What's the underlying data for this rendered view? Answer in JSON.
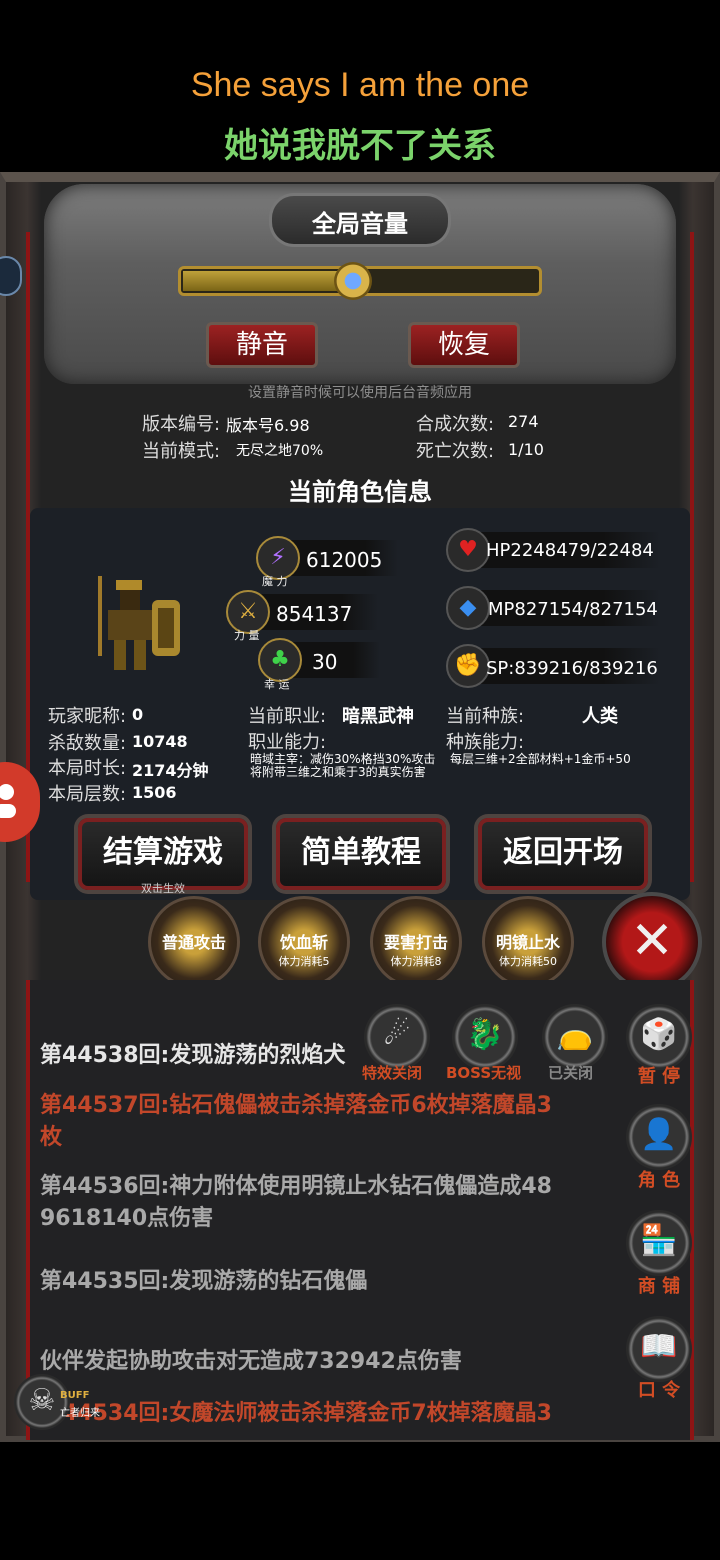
{
  "subtitle": {
    "en": "She says I am the one",
    "zh": "她说我脱不了关系"
  },
  "volume": {
    "title": "全局音量",
    "level": 0.48,
    "mute_label": "静音",
    "restore_label": "恢复",
    "hint": "设置静音时候可以使用后台音频应用"
  },
  "info": {
    "version_label": "版本编号:",
    "version_value": "版本号6.98",
    "mode_label": "当前模式:",
    "mode_value": "无尽之地70%",
    "synth_label": "合成次数:",
    "synth_value": "274",
    "death_label": "死亡次数:",
    "death_value": "1/10"
  },
  "character": {
    "section_title": "当前角色信息",
    "magic": {
      "value": "612005",
      "caption": "魔 力",
      "icon": "lightning-icon"
    },
    "power": {
      "value": "854137",
      "caption": "力 量",
      "icon": "sword-icon"
    },
    "luck": {
      "value": "30",
      "caption": "幸 运",
      "icon": "clover-icon"
    },
    "hp": {
      "value": "HP2248479/22484",
      "icon": "heart-icon"
    },
    "mp": {
      "value": "MP827154/827154",
      "icon": "mana-icon"
    },
    "sp": {
      "value": "SP:839216/839216",
      "icon": "strength-icon"
    },
    "nickname_label": "玩家昵称:",
    "nickname_value": "0",
    "kills_label": "杀敌数量:",
    "kills_value": "10748",
    "time_label": "本局时长:",
    "time_value": "2174分钟",
    "floor_label": "本局层数:",
    "floor_value": "1506",
    "job_label": "当前职业:",
    "job_value": "暗黑武神",
    "job_ability_label": "职业能力:",
    "job_ability_desc_1": "暗域主宰：减伤30%格挡30%攻击",
    "job_ability_desc_2": "将附带三维之和乘于3的真实伤害",
    "race_label": "当前种族:",
    "race_value": "人类",
    "race_ability_label": "种族能力:",
    "race_ability_desc": "每层三维+2全部材料+1金币+50"
  },
  "actions": {
    "settle": "结算游戏",
    "settle_sub": "双击生效",
    "tutorial": "简单教程",
    "back": "返回开场"
  },
  "skills": [
    {
      "name": "普通攻击",
      "cost": ""
    },
    {
      "name": "饮血斩",
      "cost": "体力消耗5"
    },
    {
      "name": "要害打击",
      "cost": "体力消耗8"
    },
    {
      "name": "明镜止水",
      "cost": "体力消耗50"
    }
  ],
  "toggles": {
    "effects": "特效关闭",
    "boss": "BOSS无视",
    "closed": "已关闭"
  },
  "side": {
    "pause": "暂 停",
    "role": "角 色",
    "shop": "商 铺",
    "code": "口 令"
  },
  "logs": [
    {
      "text": "第44538回:发现游荡的烈焰犬",
      "tone": "white"
    },
    {
      "text": "第44537回:钻石傀儡被击杀掉落金币6枚掉落魔晶3",
      "tone": "red"
    },
    {
      "text": "枚",
      "tone": "red"
    },
    {
      "text": "第44536回:神力附体使用明镜止水钻石傀儡造成48",
      "tone": "gray"
    },
    {
      "text": "9618140点伤害",
      "tone": "gray"
    },
    {
      "text": "第44535回:发现游荡的钻石傀儡",
      "tone": "gray"
    },
    {
      "text": "伙伴发起协助攻击对无造成732942点伤害",
      "tone": "gray"
    },
    {
      "text": "第44534回:女魔法师被击杀掉落金币7枚掉落魔晶3",
      "tone": "red"
    }
  ],
  "buff": {
    "label": "BUFF",
    "sub": "亡者归来"
  }
}
